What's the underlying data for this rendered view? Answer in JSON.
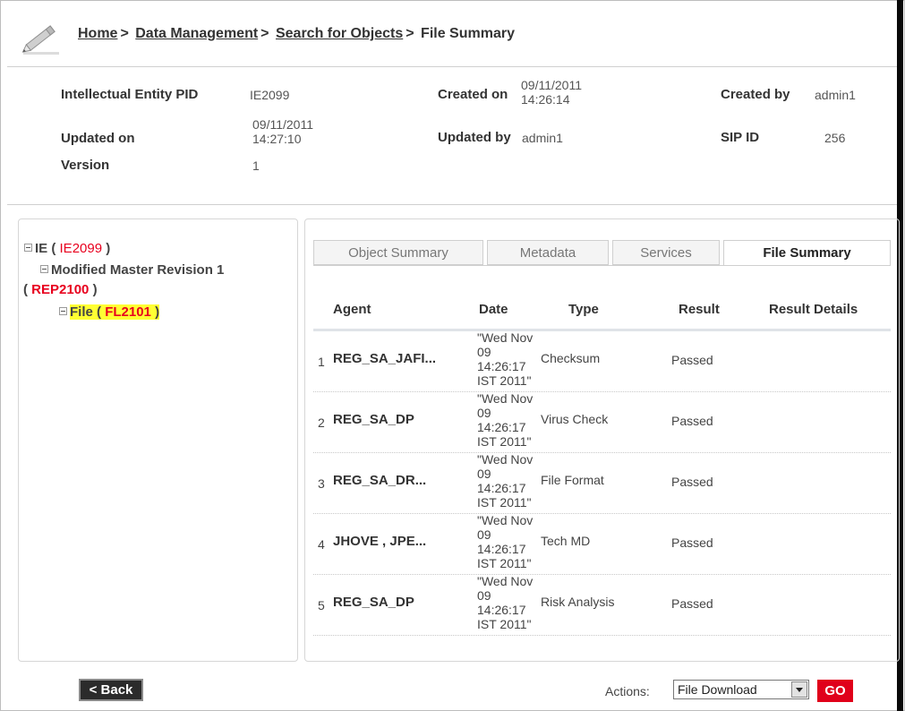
{
  "breadcrumb": {
    "items": [
      "Home",
      "Data Management",
      "Search for Objects"
    ],
    "separator": ">",
    "current": "File Summary"
  },
  "info": {
    "ie_pid_label": "Intellectual Entity PID",
    "ie_pid_value": "IE2099",
    "created_on_label": "Created on",
    "created_on_date": "09/11/2011",
    "created_on_time": "14:26:14",
    "created_by_label": "Created by",
    "created_by_value": "admin1",
    "updated_on_label": "Updated on",
    "updated_on_date": "09/11/2011",
    "updated_on_time": "14:27:10",
    "updated_by_label": "Updated by",
    "updated_by_value": "admin1",
    "sip_id_label": "SIP ID",
    "sip_id_value": "256",
    "version_label": "Version",
    "version_value": "1"
  },
  "tree": {
    "ie_label": "IE (",
    "ie_pid": "IE2099",
    "ie_close": ")",
    "rep_label": "Modified Master Revision 1",
    "rep_open": "(",
    "rep_pid": "REP2100",
    "rep_close": ")",
    "file_label": "File (",
    "file_pid": "FL2101",
    "file_close": ")"
  },
  "tabs": [
    {
      "label": "Object Summary",
      "active": false
    },
    {
      "label": "Metadata",
      "active": false
    },
    {
      "label": "Services",
      "active": false
    },
    {
      "label": "File Summary",
      "active": true
    }
  ],
  "table": {
    "headers": [
      "Agent",
      "Date",
      "Type",
      "Result",
      "Result Details"
    ],
    "rows": [
      {
        "num": "1",
        "agent": "REG_SA_JAFI...",
        "date": [
          "\"Wed Nov",
          "09 14:26:17",
          "IST 2011\""
        ],
        "type": "Checksum",
        "result": "Passed",
        "details": ""
      },
      {
        "num": "2",
        "agent": "REG_SA_DP",
        "date": [
          "\"Wed Nov",
          "09 14:26:17",
          "IST 2011\""
        ],
        "type": "Virus Check",
        "result": "Passed",
        "details": ""
      },
      {
        "num": "3",
        "agent": "REG_SA_DR...",
        "date": [
          "\"Wed Nov",
          "09 14:26:17",
          "IST 2011\""
        ],
        "type": "File Format",
        "result": "Passed",
        "details": ""
      },
      {
        "num": "4",
        "agent": "JHOVE , JPE...",
        "date": [
          "\"Wed Nov",
          "09 14:26:17",
          "IST 2011\""
        ],
        "type": "Tech MD",
        "result": "Passed",
        "details": ""
      },
      {
        "num": "5",
        "agent": "REG_SA_DP",
        "date": [
          "\"Wed Nov",
          "09 14:26:17",
          "IST 2011\""
        ],
        "type": "Risk Analysis",
        "result": "Passed",
        "details": ""
      }
    ]
  },
  "footer": {
    "back_label": "< Back",
    "actions_label": "Actions:",
    "actions_selected": "File Download",
    "go_label": "GO"
  },
  "colors": {
    "pid_red": "#e8001e",
    "highlight": "#ffff33",
    "go_button": "#e0001a",
    "back_button": "#2b2b2b"
  },
  "icons": {
    "header": "pencil-icon",
    "tree_toggle": "collapse-icon",
    "select": "dropdown-arrow-icon"
  }
}
